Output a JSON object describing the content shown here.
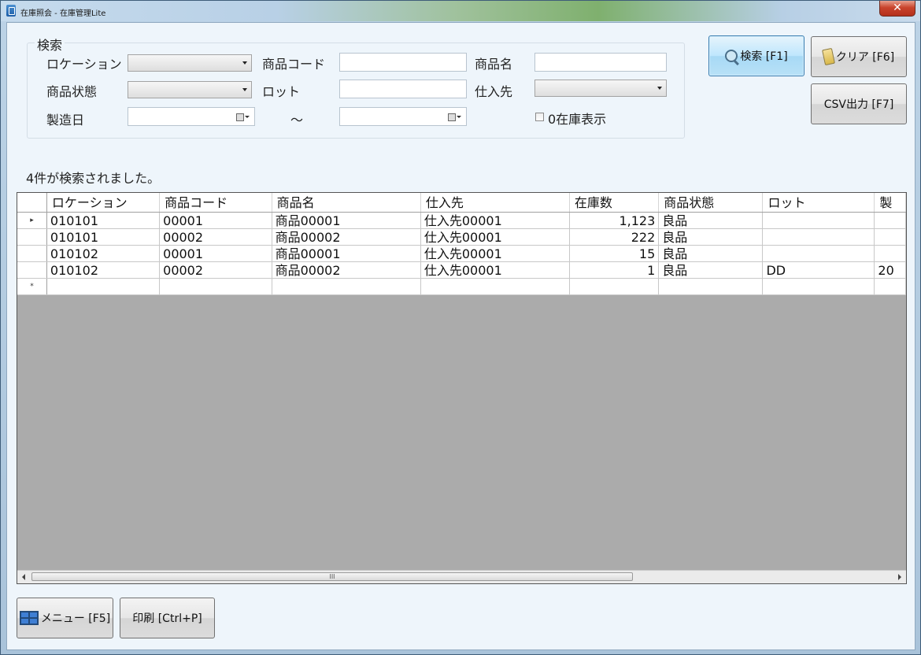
{
  "window": {
    "title": "在庫照会 - 在庫管理Lite",
    "close_label": "✕"
  },
  "search": {
    "group_label": "検索",
    "location_label": "ロケーション",
    "location_value": "",
    "product_code_label": "商品コード",
    "product_code_value": "",
    "product_name_label": "商品名",
    "product_name_value": "",
    "status_label": "商品状態",
    "status_value": "",
    "lot_label": "ロット",
    "lot_value": "",
    "supplier_label": "仕入先",
    "supplier_value": "",
    "mfg_date_label": "製造日",
    "range_sep": "～",
    "zero_stock_label": "0在庫表示",
    "zero_stock_checked": false
  },
  "buttons": {
    "search": "検索 [F1]",
    "clear": "クリア [F6]",
    "csv": "CSV出力 [F7]",
    "menu": "メニュー [F5]",
    "print": "印刷 [Ctrl+P]"
  },
  "result_status": "4件が検索されました。",
  "grid": {
    "columns": [
      "ロケーション",
      "商品コード",
      "商品名",
      "仕入先",
      "在庫数",
      "商品状態",
      "ロット",
      "製"
    ],
    "rows": [
      [
        "010101",
        "00001",
        "商品00001",
        "仕入先00001",
        "1,123",
        "良品",
        "",
        ""
      ],
      [
        "010101",
        "00002",
        "商品00002",
        "仕入先00001",
        "222",
        "良品",
        "",
        ""
      ],
      [
        "010102",
        "00001",
        "商品00001",
        "仕入先00001",
        "15",
        "良品",
        "",
        ""
      ],
      [
        "010102",
        "00002",
        "商品00002",
        "仕入先00001",
        "1",
        "良品",
        "DD",
        "20"
      ]
    ],
    "current_row_marker": "▸",
    "new_row_marker": "*",
    "scroll_thumb_grip": "III"
  }
}
